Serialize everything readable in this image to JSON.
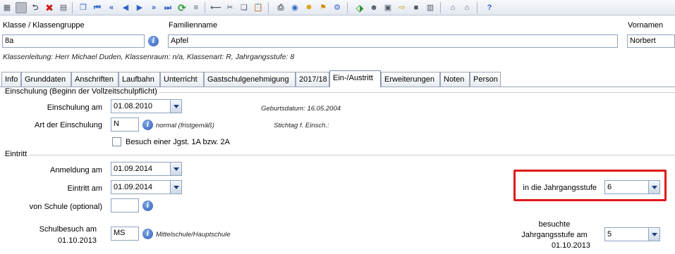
{
  "toolbar": {
    "icons": [
      "grid-icon",
      "save-disabled-icon",
      "undo-icon",
      "delete-icon",
      "calendar-icon",
      "copy-record-icon",
      "first-record-icon",
      "previous-page-icon",
      "previous-record-icon",
      "next-record-icon",
      "next-page-icon",
      "last-record-icon",
      "refresh-icon",
      "list-icon",
      "cut-marker-icon",
      "scissors-icon",
      "copy-icon",
      "paste-icon",
      "print-icon",
      "preview-icon",
      "idea-icon",
      "broom-icon",
      "settings-icon",
      "export-icon",
      "users-icon",
      "transfer-icon",
      "box-icon",
      "person-card-icon",
      "home-icon",
      "home-alt-icon",
      "help-icon"
    ]
  },
  "header": {
    "class_label": "Klasse / Klassengruppe",
    "class_value": "8a",
    "surname_label": "Familienname",
    "surname_value": "Apfel",
    "firstname_label": "Vornamen",
    "firstname_value": "Norbert",
    "status_line": "Klassenleitung: Herr Michael Duden, Klassenraum: n/a, Klassenart: R, Jahrgangsstufe: 8"
  },
  "tabs": [
    {
      "label": "Info"
    },
    {
      "label": "Grunddaten"
    },
    {
      "label": "Anschriften"
    },
    {
      "label": "Laufbahn"
    },
    {
      "label": "Unterricht"
    },
    {
      "label": "Gastschulgenehmigung"
    },
    {
      "label": "2017/18"
    },
    {
      "label": "Ein-/Austritt"
    },
    {
      "label": "Erweiterungen"
    },
    {
      "label": "Noten"
    },
    {
      "label": "Person"
    }
  ],
  "einschulung": {
    "group_title": "Einschulung (Beginn der Vollzeitschulpflicht)",
    "date_label": "Einschulung am",
    "date_value": "01.08.2010",
    "art_label": "Art der Einschulung",
    "art_value": "N",
    "art_note": "normal (fristgemäß)",
    "birth_note": "Geburtsdatum: 16.05.2004",
    "stichtag_note": "Stichtag f. Einsch.:",
    "checkbox_label": "Besuch einer Jgst. 1A bzw. 2A"
  },
  "eintritt": {
    "group_title": "Eintritt",
    "anmeldung_label": "Anmeldung am",
    "anmeldung_value": "01.09.2014",
    "eintritt_label": "Eintritt am",
    "eintritt_value": "01.09.2014",
    "jgst_label": "in die Jahrgangsstufe",
    "jgst_value": "6",
    "von_schule_label": "von Schule (optional)",
    "von_schule_value": "",
    "schulbesuch_label_1": "Schulbesuch am",
    "schulbesuch_label_2": "01.10.2013",
    "schulbesuch_value": "MS",
    "schulbesuch_note": "Mittelschule/Hauptschule",
    "besuchte_label_1": "besuchte",
    "besuchte_label_2": "Jahrgangsstufe am",
    "besuchte_label_3": "01.10.2013",
    "besuchte_value": "5"
  },
  "colors": {
    "highlight": "#e01818",
    "accent": "#2f5db8"
  }
}
